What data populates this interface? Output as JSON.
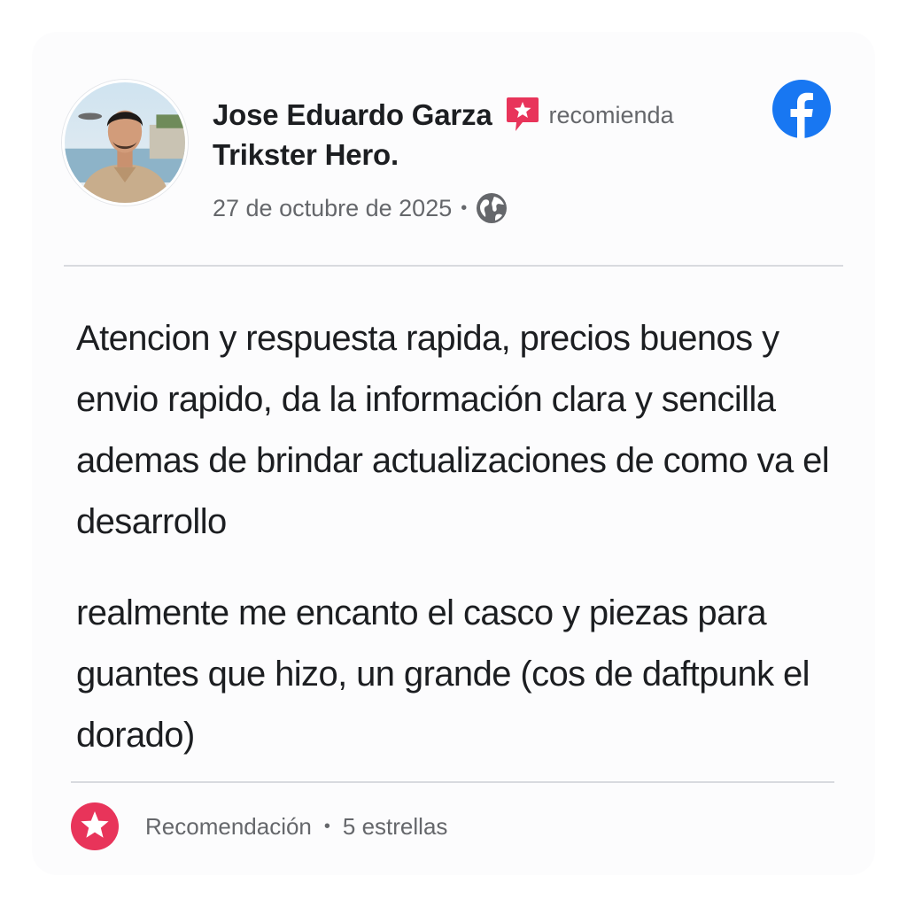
{
  "post": {
    "author": "Jose Eduardo Garza",
    "action": "recomienda",
    "page": "Trikster Hero.",
    "date": "27 de octubre de 2025",
    "separator": "•",
    "privacy_icon": "globe-icon",
    "platform_icon": "facebook-logo-icon",
    "paragraphs": [
      "Atencion y respuesta rapida, precios buenos y envio rapido, da la información clara y sencilla ademas de brindar actualizaciones de como va el desarrollo",
      "realmente me encanto el casco y piezas para guantes que hizo, un grande (cos de daftpunk el dorado)"
    ]
  },
  "footer": {
    "label": "Recomendación",
    "separator": "•",
    "rating": "5 estrellas",
    "icon": "star-icon"
  },
  "colors": {
    "recommend_accent": "#e8345a",
    "facebook_blue": "#1877f2",
    "text_primary": "#1c1e21",
    "text_secondary": "#65676b",
    "divider": "#d8dadf"
  }
}
